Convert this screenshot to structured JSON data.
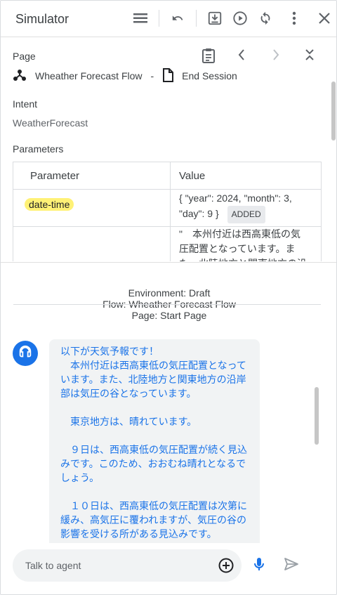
{
  "header": {
    "title": "Simulator"
  },
  "page_section": {
    "label": "Page",
    "flow_name": "Wheather Forecast Flow",
    "separator": "-",
    "page_name": "End Session"
  },
  "intent_section": {
    "label": "Intent",
    "value": "WeatherForecast"
  },
  "parameters_section": {
    "label": "Parameters",
    "columns": [
      "Parameter",
      "Value"
    ],
    "rows": [
      {
        "name": "date-time",
        "value": "{ \"year\": 2024, \"month\": 3, \"day\": 9 }",
        "badge": "ADDED"
      },
      {
        "name": "",
        "value": "\"　本州付近は西高東低の気圧配置となっています。また、北陸地方と関東地方の沿岸部は気圧の谷となって"
      }
    ]
  },
  "environment": {
    "environment": "Environment: Draft",
    "flow": "Flow: Wheather Forecast Flow",
    "page": "Page: Start Page"
  },
  "chat": {
    "agent_message": "以下が天気予報です！\n　本州付近は西高東低の気圧配置となっています。また、北陸地方と関東地方の沿岸部は気圧の谷となっています。\n\n　東京地方は、晴れています。\n\n　９日は、西高東低の気圧配置が続く見込みです。このため、おおむね晴れとなるでしょう。\n\n　１０日は、西高東低の気圧配置は次第に緩み、高気圧に覆われますが、気圧の谷の影響を受ける所がある見込みです。"
  },
  "input": {
    "placeholder": "Talk to agent"
  },
  "colors": {
    "accent": "#1a73e8",
    "highlight": "#fff176",
    "icon": "#5f6368"
  },
  "icons": [
    "reorder-icon",
    "undo-icon",
    "download-icon",
    "play-icon",
    "refresh-icon",
    "more-vert-icon",
    "close-icon",
    "clipboard-icon",
    "chevron-left-icon",
    "chevron-right-icon",
    "collapse-icon",
    "flow-icon",
    "page-icon",
    "headset-icon",
    "add-circle-icon",
    "mic-icon",
    "send-icon"
  ]
}
